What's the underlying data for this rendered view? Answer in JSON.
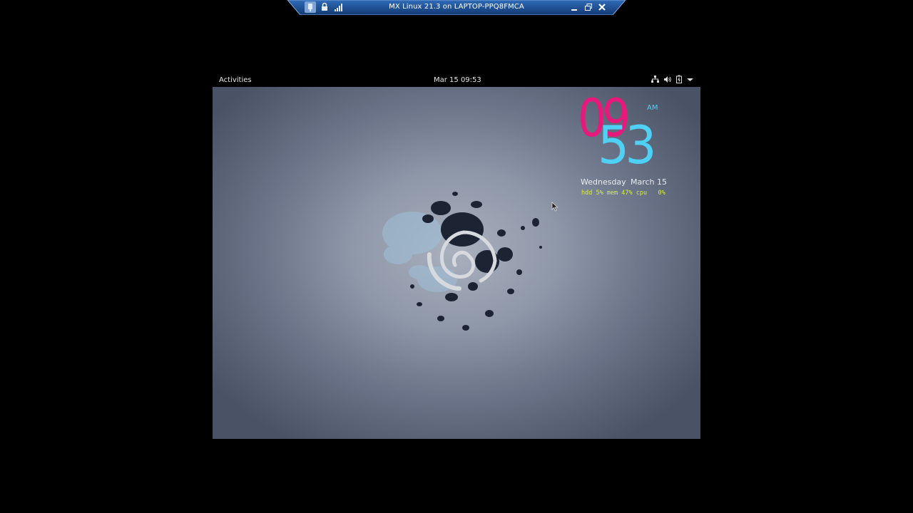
{
  "remote_desktop_bar": {
    "title": "MX Linux 21.3 on LAPTOP-PPQ8FMCA",
    "pin_icon": "pin-icon",
    "lock_icon": "lock-icon",
    "signal_icon": "signal-bars-icon",
    "minimize_icon": "minimize-icon",
    "restore_icon": "restore-icon",
    "close_icon": "close-icon"
  },
  "top_panel": {
    "activities_label": "Activities",
    "datetime": "Mar 15  09:53",
    "tray_icons": [
      "network-icon",
      "volume-icon",
      "battery-icon",
      "dropdown-arrow-icon"
    ]
  },
  "conky": {
    "hour": "09",
    "minute": "53",
    "ampm": "AM",
    "weekday": "Wednesday",
    "date": "March 15",
    "stats": "hdd 5% mem 47% cpu   0%"
  },
  "colors": {
    "hour": "#e8187c",
    "minute": "#4fd1f6",
    "stats": "#d8f03a",
    "rd_bar": "#1a4a8c"
  }
}
